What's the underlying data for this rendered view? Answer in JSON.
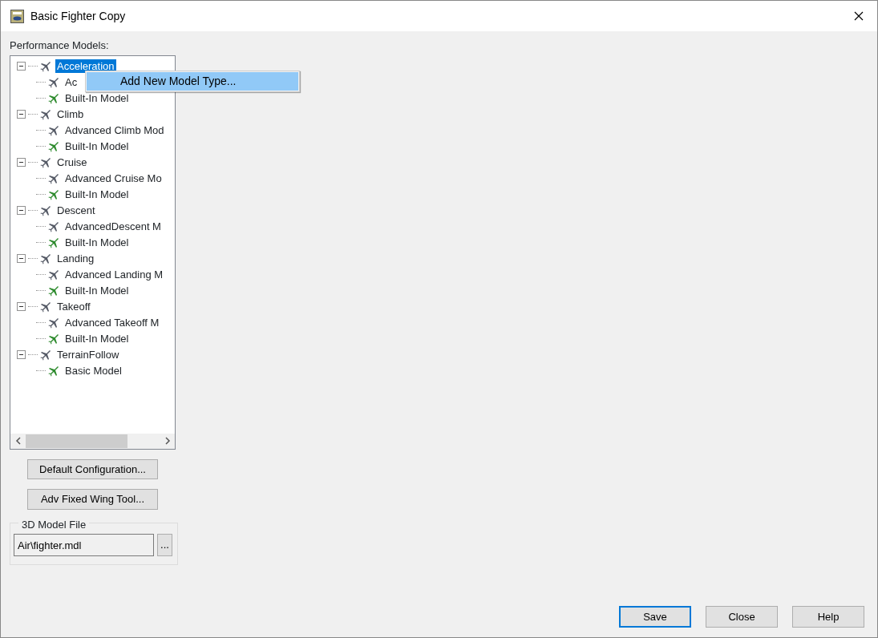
{
  "window": {
    "title": "Basic Fighter Copy"
  },
  "tree_label": "Performance Models:",
  "tree": [
    {
      "label": "Acceleration",
      "selected": true,
      "expanded": true,
      "children": [
        {
          "label": "Ac",
          "kind": "advanced",
          "selected": false
        },
        {
          "label": "Built-In Model",
          "kind": "builtin",
          "selected": false
        }
      ]
    },
    {
      "label": "Climb",
      "selected": false,
      "expanded": true,
      "children": [
        {
          "label": "Advanced Climb Mod",
          "kind": "advanced",
          "selected": false
        },
        {
          "label": "Built-In Model",
          "kind": "builtin",
          "selected": false
        }
      ]
    },
    {
      "label": "Cruise",
      "selected": false,
      "expanded": true,
      "children": [
        {
          "label": "Advanced Cruise Mo",
          "kind": "advanced",
          "selected": false
        },
        {
          "label": "Built-In Model",
          "kind": "builtin",
          "selected": false
        }
      ]
    },
    {
      "label": "Descent",
      "selected": false,
      "expanded": true,
      "children": [
        {
          "label": "AdvancedDescent M",
          "kind": "advanced",
          "selected": false
        },
        {
          "label": "Built-In Model",
          "kind": "builtin",
          "selected": false
        }
      ]
    },
    {
      "label": "Landing",
      "selected": false,
      "expanded": true,
      "children": [
        {
          "label": "Advanced Landing M",
          "kind": "advanced",
          "selected": false
        },
        {
          "label": "Built-In Model",
          "kind": "builtin",
          "selected": false
        }
      ]
    },
    {
      "label": "Takeoff",
      "selected": false,
      "expanded": true,
      "children": [
        {
          "label": "Advanced Takeoff M",
          "kind": "advanced",
          "selected": false
        },
        {
          "label": "Built-In Model",
          "kind": "builtin",
          "selected": false
        }
      ]
    },
    {
      "label": "TerrainFollow",
      "selected": false,
      "expanded": true,
      "children": [
        {
          "label": "Basic Model",
          "kind": "builtin",
          "selected": false
        }
      ]
    }
  ],
  "context_menu": [
    {
      "label": "Add New Model Type...",
      "selected": true
    }
  ],
  "side_buttons": [
    "Default Configuration...",
    "Adv Fixed Wing Tool..."
  ],
  "model_file": {
    "legend": "3D Model File",
    "value": "Air\\fighter.mdl",
    "browse": "..."
  },
  "footer_buttons": [
    {
      "label": "Save",
      "default": true
    },
    {
      "label": "Close",
      "default": false
    },
    {
      "label": "Help",
      "default": false
    }
  ]
}
